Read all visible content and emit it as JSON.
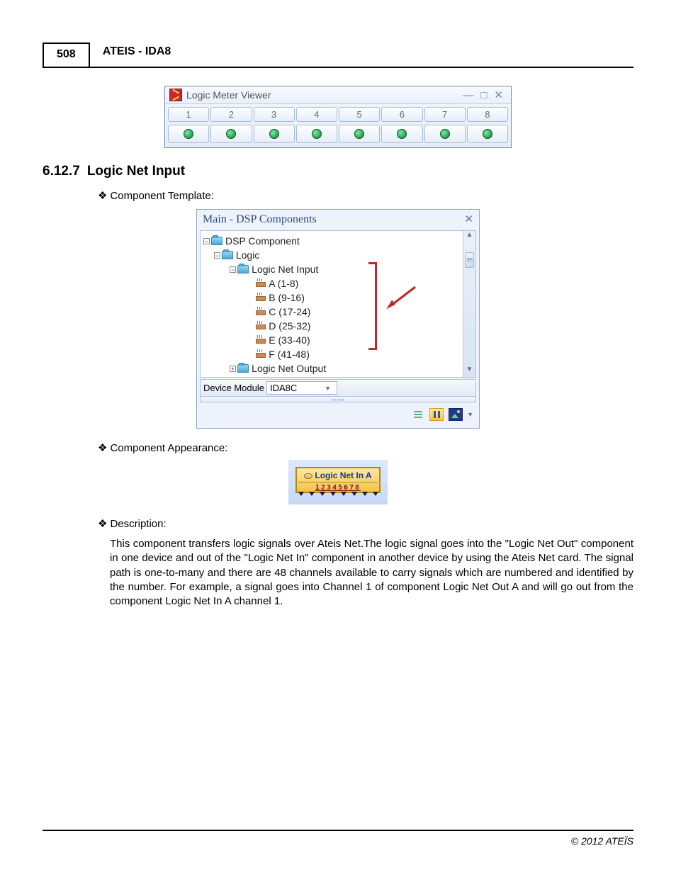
{
  "header": {
    "page_number": "508",
    "title": "ATEIS - IDA8"
  },
  "fig1": {
    "title": "Logic Meter Viewer",
    "cells": [
      "1",
      "2",
      "3",
      "4",
      "5",
      "6",
      "7",
      "8"
    ]
  },
  "section": {
    "number": "6.12.7",
    "title": "Logic Net Input"
  },
  "bullets": {
    "template": "Component Template:",
    "appearance": "Component Appearance:",
    "description": "Description:"
  },
  "fig2": {
    "title": "Main - DSP Components",
    "root": "DSP Component",
    "logic": "Logic",
    "lni": "Logic Net Input",
    "leaves": [
      "A (1-8)",
      "B (9-16)",
      "C (17-24)",
      "D (25-32)",
      "E (33-40)",
      "F (41-48)"
    ],
    "lno": "Logic Net Output",
    "device_label": "Device Module",
    "device_value": "IDA8C"
  },
  "fig3": {
    "label": "Logic Net In A"
  },
  "description": "This component transfers logic signals over Ateis Net.The logic signal goes into the \"Logic Net Out\" component in one device and out of the \"Logic Net In\" component in another device by using the Ateis Net card. The signal path is one-to-many and there are 48 channels available to carry signals which are numbered and identified by the number. For example, a signal goes into Channel 1 of component Logic Net Out A and will go out from  the component Logic Net In A channel 1.",
  "footer": "© 2012 ATEÏS"
}
